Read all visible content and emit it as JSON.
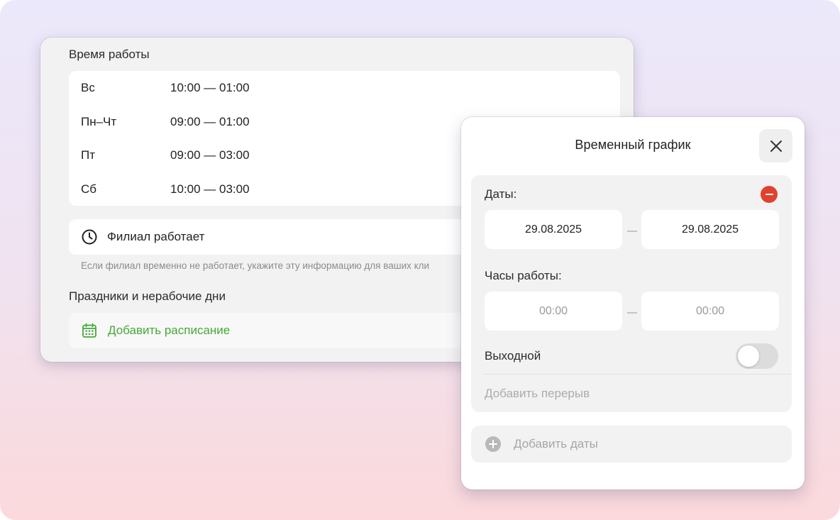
{
  "working_hours": {
    "title": "Время работы",
    "rows": [
      {
        "day": "Вс",
        "hours": "10:00 — 01:00"
      },
      {
        "day": "Пн–Чт",
        "hours": "09:00 — 01:00"
      },
      {
        "day": "Пт",
        "hours": "09:00 — 03:00"
      },
      {
        "day": "Сб",
        "hours": "10:00 — 03:00"
      }
    ]
  },
  "branch_status": {
    "label": "Филиал работает",
    "hint": "Если филиал временно не работает, укажите эту информацию для ваших кли"
  },
  "holidays": {
    "title": "Праздники и нерабочие дни",
    "add_label": "Добавить расписание"
  },
  "modal": {
    "title": "Временный график",
    "dates_label": "Даты:",
    "date_from": "29.08.2025",
    "date_to": "29.08.2025",
    "hours_label": "Часы работы:",
    "time_from_placeholder": "00:00",
    "time_to_placeholder": "00:00",
    "day_off_label": "Выходной",
    "day_off_enabled": false,
    "add_break_label": "Добавить перерыв",
    "add_dates_label": "Добавить даты"
  },
  "colors": {
    "accent_green": "#45a83a",
    "remove_red": "#e0422f"
  }
}
